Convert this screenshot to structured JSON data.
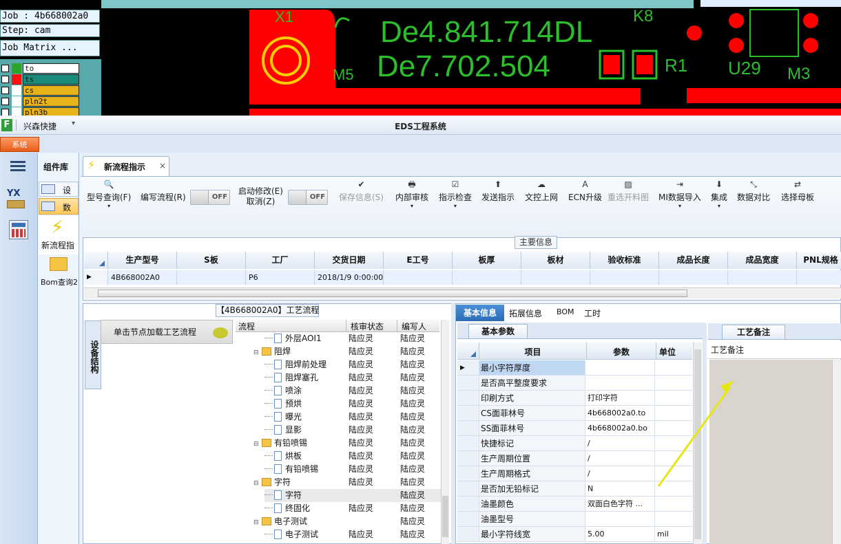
{
  "cam": {
    "job_label": "Job : 4b668002a0",
    "step_label": "Step: cam",
    "job_matrix_button": "Job Matrix ...",
    "layers": [
      {
        "name": "to",
        "color": "#2aa52a",
        "bg": "#ffffff"
      },
      {
        "name": "ts",
        "color": "#ff1010",
        "bg": "#1c8c7a"
      },
      {
        "name": "cs",
        "color": "#ffffff",
        "bg": "#e7b21a"
      },
      {
        "name": "pln2t",
        "color": "#ffffff",
        "bg": "#e7b21a"
      },
      {
        "name": "pln3b",
        "color": "#ffffff",
        "bg": "#e7b21a"
      }
    ],
    "pcb_text": {
      "x1": "X1",
      "k8": "K8",
      "m5": "M5",
      "r1": "R1",
      "u29": "U29",
      "m3": "M3",
      "de_line1": "De4.841.714DL",
      "de_line2": "De7.702.504"
    }
  },
  "app": {
    "quick_label": "兴森快捷",
    "window_title": "EDS工程系统",
    "system_menu": "系统"
  },
  "nav": {
    "component_lib": "组件库",
    "items": [
      "设",
      "数"
    ],
    "new_process": "新流程指",
    "bom_query": "Bom查询2"
  },
  "tab": {
    "label": "新流程指示",
    "close": "×"
  },
  "toolbar": {
    "model_query": "型号查询(F)",
    "write_flow": "编写流程(R)",
    "toggle_off": "OFF",
    "enable_modify": "启动修改(E)",
    "cancel": "取消(Z)",
    "save_info": "保存信息(S)",
    "internal_review": "内部审核",
    "instruction_check": "指示检查",
    "send_instruction": "发送指示",
    "upload_online": "文控上网",
    "ecn_upgrade": "ECN升级",
    "reselect_cutting": "重选开料图",
    "mi_import": "MI数据导入",
    "integrate": "集成",
    "data_compare": "数据对比",
    "select_master": "选择母板"
  },
  "main_info": {
    "title": "主要信息",
    "headers": [
      "生产型号",
      "S板",
      "工厂",
      "交货日期",
      "E工号",
      "板厚",
      "板材",
      "验收标准",
      "成品长度",
      "成品宽度",
      "PNL规格"
    ],
    "row": [
      "4B668002A0",
      "",
      "P6",
      "2018/1/9 0:00:00",
      "",
      "",
      "",
      "",
      "",
      "",
      ""
    ]
  },
  "process": {
    "title": "【4B668002A0】工艺流程",
    "vertical_tab": "设备结构",
    "click_hint": "单击节点加载工艺流程",
    "col_flow": "流程",
    "col_status": "核审状态",
    "col_editor": "编写人",
    "rows": [
      {
        "name": "外层AOI1",
        "status": "陆应灵",
        "editor": "陆应灵",
        "type": "doc"
      },
      {
        "name": "阻焊",
        "status": "陆应灵",
        "editor": "陆应灵",
        "type": "folder"
      },
      {
        "name": "阻焊前处理",
        "status": "陆应灵",
        "editor": "陆应灵",
        "type": "doc"
      },
      {
        "name": "阻焊塞孔",
        "status": "陆应灵",
        "editor": "陆应灵",
        "type": "doc"
      },
      {
        "name": "喷涂",
        "status": "陆应灵",
        "editor": "陆应灵",
        "type": "doc"
      },
      {
        "name": "预烘",
        "status": "陆应灵",
        "editor": "陆应灵",
        "type": "doc"
      },
      {
        "name": "曝光",
        "status": "陆应灵",
        "editor": "陆应灵",
        "type": "doc"
      },
      {
        "name": "显影",
        "status": "陆应灵",
        "editor": "陆应灵",
        "type": "doc"
      },
      {
        "name": "有铅喷锡",
        "status": "陆应灵",
        "editor": "陆应灵",
        "type": "folder"
      },
      {
        "name": "烘板",
        "status": "陆应灵",
        "editor": "陆应灵",
        "type": "doc"
      },
      {
        "name": "有铅喷锡",
        "status": "陆应灵",
        "editor": "陆应灵",
        "type": "doc"
      },
      {
        "name": "字符",
        "status": "陆应灵",
        "editor": "陆应灵",
        "type": "folder"
      },
      {
        "name": "字符",
        "status": "",
        "editor": "陆应灵",
        "type": "doc"
      },
      {
        "name": "终固化",
        "status": "陆应灵",
        "editor": "陆应灵",
        "type": "doc"
      },
      {
        "name": "电子测试",
        "status": "",
        "editor": "陆应灵",
        "type": "folder"
      },
      {
        "name": "电子测试",
        "status": "陆应灵",
        "editor": "陆应灵",
        "type": "doc"
      }
    ]
  },
  "detail": {
    "tabs": [
      "基本信息",
      "拓展信息",
      "BOM",
      "工时"
    ],
    "basic_params": "基本参数",
    "col_item": "项目",
    "col_param": "参数",
    "col_unit": "单位",
    "rows": [
      {
        "item": "最小字符厚度",
        "param": "",
        "unit": ""
      },
      {
        "item": "是否高平整度要求",
        "param": "",
        "unit": ""
      },
      {
        "item": "印刷方式",
        "param": "打印字符",
        "unit": ""
      },
      {
        "item": "CS面菲林号",
        "param": "4b668002a0.to",
        "unit": ""
      },
      {
        "item": "SS面菲林号",
        "param": "4b668002a0.bo",
        "unit": ""
      },
      {
        "item": "快捷标记",
        "param": "/",
        "unit": ""
      },
      {
        "item": "生产周期位置",
        "param": "/",
        "unit": ""
      },
      {
        "item": "生产周期格式",
        "param": "/",
        "unit": ""
      },
      {
        "item": "是否加无铅标记",
        "param": "N",
        "unit": ""
      },
      {
        "item": "油墨颜色",
        "param": "双面白色字符 ...",
        "unit": ""
      },
      {
        "item": "油墨型号",
        "param": "",
        "unit": ""
      },
      {
        "item": "最小字符线宽",
        "param": "5.00",
        "unit": "mil"
      }
    ],
    "process_notes_tab": "工艺备注",
    "process_notes_label": "工艺备注"
  }
}
